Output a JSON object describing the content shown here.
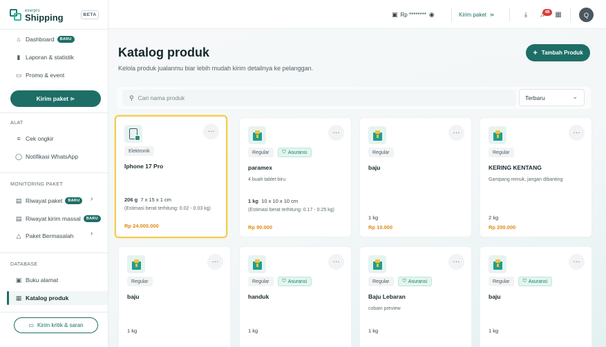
{
  "brand": {
    "small": "everpro",
    "name": "Shipping",
    "beta": "BETA"
  },
  "sidebar": {
    "items": [
      {
        "label": "Dashboard",
        "badge": "BARU"
      },
      {
        "label": "Laporan & statistik"
      },
      {
        "label": "Promo & event"
      }
    ],
    "kirim_label": "Kirim paket ⋗",
    "sections": {
      "alat": "ALAT",
      "monitoring": "MONITORING PAKET",
      "database": "DATABASE"
    },
    "alat_items": [
      {
        "label": "Cek ongkir"
      },
      {
        "label": "Notifikasi WhatsApp"
      }
    ],
    "monitoring_items": [
      {
        "label": "Riwayat paket",
        "badge": "BARU"
      },
      {
        "label": "Riwayat kirim massal",
        "badge": "BARU"
      },
      {
        "label": "Paket Bermasalah"
      }
    ],
    "database_items": [
      {
        "label": "Buku alamat"
      },
      {
        "label": "Katalog produk"
      }
    ],
    "kritik_label": "Kirim kritik & saran"
  },
  "topbar": {
    "saldo": "Rp ********",
    "kirim_label": "Kirim paket",
    "notif_count": "48",
    "avatar": "Q"
  },
  "main": {
    "title": "Katalog produk",
    "subtitle": "Kelola produk jualanmu biar lebih mudah kirim detailnya ke pelanggan.",
    "add_button": "Tambah Produk",
    "search_placeholder": "Cari nama produk",
    "sort_value": "Terbaru"
  },
  "products": [
    {
      "category": "Elektronik",
      "insured": "",
      "name": "Iphone 17 Pro",
      "desc": "",
      "weight": "206 g",
      "dims": "7 x 15 x 1 cm",
      "est": "(Estimasi berat terhitung: 0.02 - 0.03 kg)",
      "price": "Rp 24.000.000"
    },
    {
      "category": "Regular",
      "insured": "Asuransi",
      "name": "paramex",
      "desc": "4 buah tablet biru",
      "weight": "1 kg",
      "dims": "10 x 10 x 10 cm",
      "est": "(Estimasi berat terhitung: 0.17 - 0.25 kg)",
      "price": "Rp 90.000"
    },
    {
      "category": "Regular",
      "insured": "",
      "name": "baju",
      "desc": "",
      "weight": "1 kg",
      "dims": "",
      "est": "",
      "price": "Rp 10.000"
    },
    {
      "category": "Regular",
      "insured": "",
      "name": "KERING KENTANG",
      "desc": "Gampang remuk, jangan dibanting",
      "weight": "2 kg",
      "dims": "",
      "est": "",
      "price": "Rp 200.000"
    },
    {
      "category": "Regular",
      "insured": "",
      "name": "baju",
      "desc": "",
      "weight": "1 kg",
      "dims": "",
      "est": "",
      "price": ""
    },
    {
      "category": "Regular",
      "insured": "Asuransi",
      "name": "handuk",
      "desc": "",
      "weight": "1 kg",
      "dims": "",
      "est": "",
      "price": ""
    },
    {
      "category": "Regular",
      "insured": "Asuransi",
      "name": "Baju Lebaran",
      "desc": "cobain preview",
      "weight": "1 kg",
      "dims": "",
      "est": "",
      "price": ""
    },
    {
      "category": "Regular",
      "insured": "Asuransi",
      "name": "baju",
      "desc": "",
      "weight": "1 kg",
      "dims": "",
      "est": "",
      "price": ""
    }
  ],
  "colors": {
    "primary": "#1d6e66",
    "price": "#e08a15",
    "highlight": "#f1cd56",
    "badge_red": "#d93c3c"
  }
}
